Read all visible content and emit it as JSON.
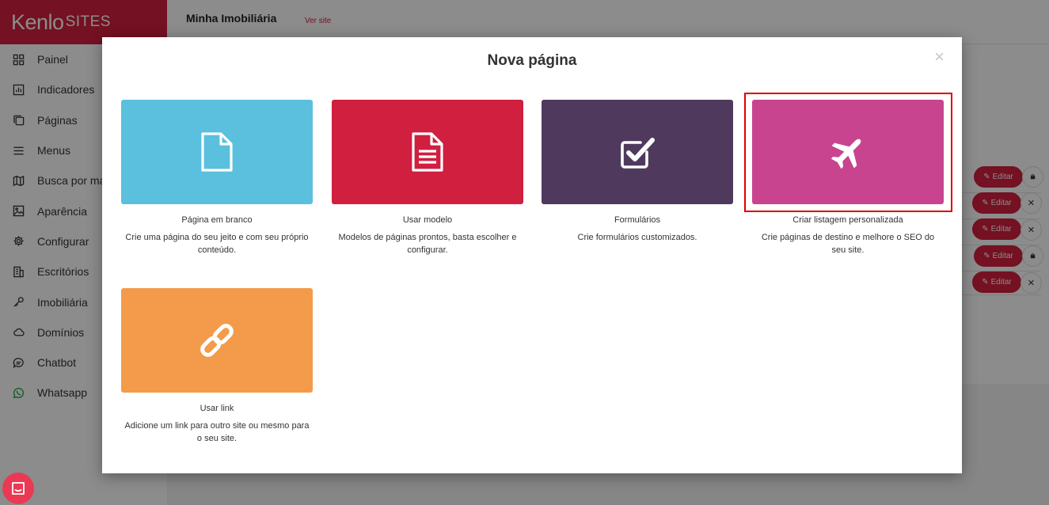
{
  "brand": {
    "logo_main": "Kenlo",
    "logo_sub": "SITES"
  },
  "sidebar": {
    "items": [
      {
        "label": "Painel",
        "icon": "grid-icon"
      },
      {
        "label": "Indicadores",
        "icon": "chart-icon"
      },
      {
        "label": "Páginas",
        "icon": "pages-icon"
      },
      {
        "label": "Menus",
        "icon": "menu-icon"
      },
      {
        "label": "Busca por mapa",
        "icon": "map-icon"
      },
      {
        "label": "Aparência",
        "icon": "image-icon"
      },
      {
        "label": "Configurar",
        "icon": "gear-icon"
      },
      {
        "label": "Escritórios",
        "icon": "building-icon"
      },
      {
        "label": "Imobiliária",
        "icon": "key-icon"
      },
      {
        "label": "Domínios",
        "icon": "cloud-icon"
      },
      {
        "label": "Chatbot",
        "icon": "chat-icon"
      },
      {
        "label": "Whatsapp",
        "icon": "whatsapp-icon"
      }
    ]
  },
  "header": {
    "site_name": "Minha Imobiliária",
    "site_link": "Ver site"
  },
  "background_rows": {
    "edit_label": "Editar",
    "rows": [
      {
        "secondary": "lock-icon"
      },
      {
        "secondary": "close-icon"
      },
      {
        "secondary": "close-icon"
      },
      {
        "secondary": "lock-icon"
      },
      {
        "secondary": "close-icon"
      }
    ]
  },
  "modal": {
    "title": "Nova página",
    "close": "×",
    "options": [
      {
        "title": "Página em branco",
        "desc": "Crie uma página do seu jeito e com seu próprio conteúdo.",
        "color": "#5bc0de",
        "icon": "blank-page-icon"
      },
      {
        "title": "Usar modelo",
        "desc": "Modelos de páginas prontos, basta escolher e configurar.",
        "color": "#d01f3f",
        "icon": "template-page-icon"
      },
      {
        "title": "Formulários",
        "desc": "Crie formulários customizados.",
        "color": "#4f3a5e",
        "icon": "checkbox-icon"
      },
      {
        "title": "Criar listagem personalizada",
        "desc": "Crie páginas de destino e melhore o SEO do seu site.",
        "color": "#c9448f",
        "icon": "plane-icon"
      },
      {
        "title": "Usar link",
        "desc": "Adicione um link para outro site ou mesmo para o seu site.",
        "color": "#f39b4a",
        "icon": "link-icon"
      }
    ]
  },
  "colors": {
    "brand": "#d31f3f",
    "highlight": "#e00000",
    "chat": "#ea3a53"
  }
}
